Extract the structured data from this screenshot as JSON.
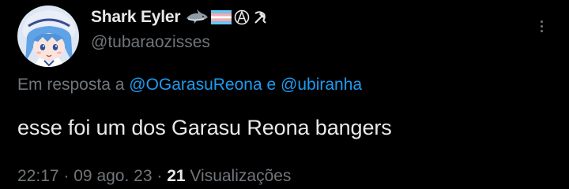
{
  "author": {
    "display_name": "Shark Eyler",
    "handle": "@tubaraozisses",
    "name_emojis": [
      "shark-emoji",
      "transgender-flag-emoji",
      "circled-a-emoji",
      "hammer-and-sickle-emoji"
    ],
    "avatar": "anime-avatar"
  },
  "reply": {
    "prefix": "Em resposta a",
    "mention_1": "@OGarasuReona",
    "conjunction": "e",
    "mention_2": "@ubiranha"
  },
  "tweet": {
    "text": "esse foi um dos Garasu Reona bangers"
  },
  "meta": {
    "time": "22:17",
    "separator": "·",
    "date": "09 ago. 23",
    "views_count": "21",
    "views_label": "Visualizações"
  },
  "more_icon": "more-dots-icon",
  "colors": {
    "background": "#000000",
    "text_primary": "#e7e9ea",
    "text_secondary": "#71767b",
    "link": "#1d9bf0"
  }
}
